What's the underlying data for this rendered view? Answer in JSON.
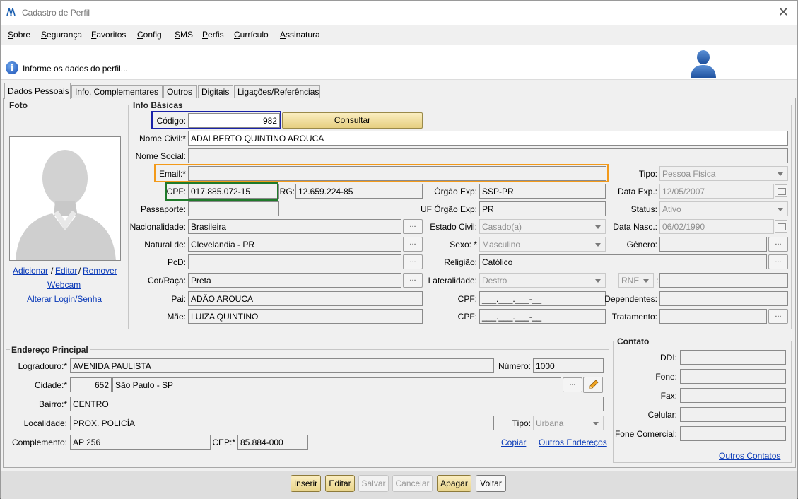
{
  "window": {
    "title": "Cadastro de Perfil"
  },
  "menu": [
    "Sobre",
    "Segurança",
    "Favoritos",
    "Config",
    "SMS",
    "Perfis",
    "Currículo",
    "Assinatura"
  ],
  "info_message": "Informe os dados do perfil...",
  "tabs": [
    "Dados Pessoais",
    "Info. Complementares",
    "Outros",
    "Digitais",
    "Ligações/Referências"
  ],
  "foto": {
    "title": "Foto",
    "adicionar": "Adicionar",
    "sep1": "/",
    "editar": "Editar",
    "sep2": "/",
    "remover": "Remover",
    "webcam": "Webcam",
    "alterar_login": "Alterar Login/Senha"
  },
  "info_basicas": {
    "title": "Info Básicas",
    "codigo_label": "Código:",
    "codigo_value": "982",
    "consultar": "Consultar",
    "nome_civil_label": "Nome Civil:*",
    "nome_civil_value": "ADALBERTO QUINTINO AROUCA",
    "nome_social_label": "Nome Social:",
    "nome_social_value": "",
    "email_label": "Email:*",
    "email_value": "",
    "tipo_label": "Tipo:",
    "tipo_value": "Pessoa Física",
    "cpf_label": "CPF:",
    "cpf_value": "017.885.072-15",
    "rg_label": "RG:",
    "rg_value": "12.659.224-85",
    "orgao_exp_label": "Órgão Exp:",
    "orgao_exp_value": "SSP-PR",
    "data_exp_label": "Data Exp.:",
    "data_exp_value": "12/05/2007",
    "passaporte_label": "Passaporte:",
    "passaporte_value": "",
    "uf_orgao_exp_label": "UF Órgão Exp:",
    "uf_orgao_exp_value": "PR",
    "status_label": "Status:",
    "status_value": "Ativo",
    "nacionalidade_label": "Nacionalidade:",
    "nacionalidade_value": "Brasileira",
    "estado_civil_label": "Estado Civil:",
    "estado_civil_value": "Casado(a)",
    "data_nasc_label": "Data Nasc.:",
    "data_nasc_value": "06/02/1990",
    "natural_label": "Natural de:",
    "natural_value": "Clevelandia - PR",
    "sexo_label": "Sexo: *",
    "sexo_value": "Masculino",
    "genero_label": "Gênero:",
    "genero_value": "",
    "pcd_label": "PcD:",
    "pcd_value": "",
    "religiao_label": "Religião:",
    "religiao_value": "Católico",
    "cor_raca_label": "Cor/Raça:",
    "cor_raca_value": "Preta",
    "lateralidade_label": "Lateralidade:",
    "lateralidade_value": "Destro",
    "rne_value": "RNE",
    "rne_colon": ":",
    "rne_field_value": "",
    "pai_label": "Pai:",
    "pai_value": "ADÃO AROUCA",
    "cpf_pai_label": "CPF:",
    "cpf_pai_value": "___.___.___-__",
    "dependentes_label": "Dependentes:",
    "dependentes_value": "",
    "mae_label": "Mãe:",
    "mae_value": "LUIZA QUINTINO",
    "cpf_mae_label": "CPF:",
    "cpf_mae_value": "___.___.___-__",
    "tratamento_label": "Tratamento:",
    "tratamento_value": ""
  },
  "ellipsis": "...",
  "endereco": {
    "title": "Endereço Principal",
    "logradouro_label": "Logradouro:*",
    "logradouro_value": "AVENIDA PAULISTA",
    "numero_label": "Número:",
    "numero_value": "1000",
    "cidade_label": "Cidade:*",
    "cidade_code": "652",
    "cidade_value": "São Paulo - SP",
    "bairro_label": "Bairro:*",
    "bairro_value": "CENTRO",
    "localidade_label": "Localidade:",
    "localidade_value": "PROX. POLICÍA",
    "tipo_label": "Tipo:",
    "tipo_value": "Urbana",
    "complemento_label": "Complemento:",
    "complemento_value": "AP 256",
    "cep_label": "CEP:*",
    "cep_value": "85.884-000",
    "copiar": "Copiar",
    "outros_enderecos": "Outros Endereços"
  },
  "contato": {
    "title": "Contato",
    "ddi_label": "DDI:",
    "fone_label": "Fone:",
    "fax_label": "Fax:",
    "celular_label": "Celular:",
    "fone_comercial_label": "Fone Comercial:",
    "outros_contatos": "Outros Contatos"
  },
  "buttons": {
    "inserir": "Inserir",
    "editar": "Editar",
    "salvar": "Salvar",
    "cancelar": "Cancelar",
    "apagar": "Apagar",
    "voltar": "Voltar"
  },
  "colors": {
    "highlight_codigo": "#1a22a8",
    "highlight_email": "#f39a1a",
    "highlight_cpf": "#1f7a2a",
    "link": "#0a3ab8",
    "button_gold": "#e9d48a"
  }
}
